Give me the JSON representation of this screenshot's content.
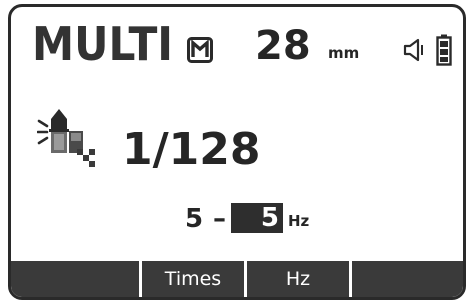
{
  "display": {
    "mode": "MULTI",
    "focal_length": "28",
    "focal_unit": "mm",
    "flash_icon": "flash-head-icon",
    "sound_icon": "speaker-icon",
    "battery_icon": "battery-icon",
    "multi_icon": "multi-flash-icon"
  },
  "settings": {
    "ratio": "1/128",
    "freq_from": "5",
    "freq_dash": "–",
    "freq_to": "5",
    "freq_unit": "Hz"
  },
  "softkeys": [
    {
      "label": ""
    },
    {
      "label": "Times"
    },
    {
      "label": "Hz"
    },
    {
      "label": ""
    }
  ],
  "colors": {
    "lcd_text": "#262626",
    "softkey_bg": "#3a3a3a",
    "highlight_bg": "#2e2e2e"
  }
}
